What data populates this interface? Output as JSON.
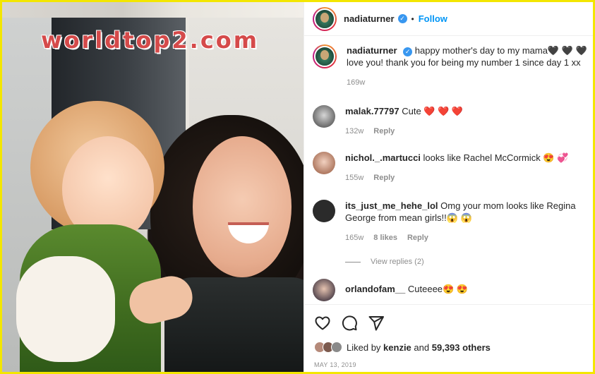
{
  "watermark": "worldtop2.com",
  "post": {
    "username": "nadiaturner",
    "follow_label": "Follow",
    "dot": "•",
    "caption_text": "happy mother's day to my mama🖤 🖤 🖤 love you! thank you for being my number 1 since day 1 xx",
    "caption_time": "169w"
  },
  "comments": [
    {
      "user": "malak.77797",
      "text": "Cute ❤️ ❤️ ❤️",
      "time": "132w",
      "likes": "",
      "reply": "Reply"
    },
    {
      "user": "nichol._.martucci",
      "text": "looks like Rachel McCormick 😍 💞",
      "time": "155w",
      "likes": "",
      "reply": "Reply"
    },
    {
      "user": "its_just_me_hehe_lol",
      "text": "Omg your mom looks like Regina George from mean girls!!😱 😱",
      "time": "165w",
      "likes": "8 likes",
      "reply": "Reply"
    },
    {
      "user": "orlandofam__",
      "text": "Cuteeee😍 😍",
      "time": "",
      "likes": "",
      "reply": ""
    }
  ],
  "view_replies": "View replies (2)",
  "likes": {
    "prefix": "Liked by",
    "user": "kenzie",
    "and": "and",
    "others": "59,393 others"
  },
  "date": "MAY 13, 2019",
  "icons": [
    "heart-icon",
    "comment-icon",
    "share-icon"
  ]
}
